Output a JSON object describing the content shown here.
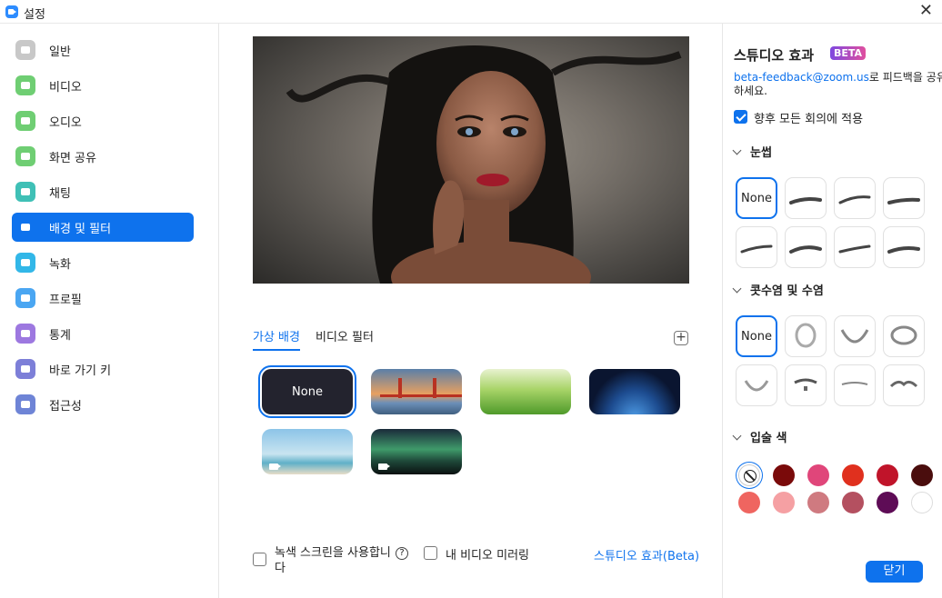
{
  "window": {
    "title": "설정",
    "close_glyph": "✕"
  },
  "sidebar": {
    "items": [
      {
        "label": "일반",
        "icon": "gear-icon",
        "color": "#c8c8c8"
      },
      {
        "label": "비디오",
        "icon": "video-icon",
        "color": "#6fce73"
      },
      {
        "label": "오디오",
        "icon": "headphones-icon",
        "color": "#6fce73"
      },
      {
        "label": "화면 공유",
        "icon": "screen-share-icon",
        "color": "#6fce73"
      },
      {
        "label": "채팅",
        "icon": "chat-icon",
        "color": "#3fc0b6"
      },
      {
        "label": "배경 및 필터",
        "icon": "person-card-icon",
        "color": "#0e72ed",
        "active": true
      },
      {
        "label": "녹화",
        "icon": "record-icon",
        "color": "#32b7e8"
      },
      {
        "label": "프로필",
        "icon": "profile-icon",
        "color": "#4aa6f2"
      },
      {
        "label": "통계",
        "icon": "stats-icon",
        "color": "#9d78e0"
      },
      {
        "label": "바로 가기 키",
        "icon": "keyboard-icon",
        "color": "#7d7fd8"
      },
      {
        "label": "접근성",
        "icon": "accessibility-icon",
        "color": "#6e84d6"
      }
    ]
  },
  "center": {
    "tabs": [
      {
        "label": "가상 배경",
        "active": true
      },
      {
        "label": "비디오 필터",
        "active": false
      }
    ],
    "add_glyph": "+",
    "backgrounds": [
      {
        "label": "None",
        "kind": "none",
        "selected": true
      },
      {
        "kind": "golden-gate"
      },
      {
        "kind": "grass"
      },
      {
        "kind": "earth"
      },
      {
        "kind": "beach",
        "video": true
      },
      {
        "kind": "aurora",
        "video": true
      }
    ],
    "green_screen_label": "녹색 스크린을 사용합니다",
    "help_glyph": "?",
    "mirror_label": "내 비디오 미러링",
    "studio_link": "스튜디오 효과(Beta)"
  },
  "studio": {
    "title": "스튜디오 효과",
    "beta": "BETA",
    "feedback_link": "beta-feedback@zoom.us",
    "feedback_text": "로 피드백을 공유하세요.",
    "apply_label": "향후 모든 회의에 적용",
    "apply_checked": true,
    "eyebrows": {
      "title": "눈썹",
      "none_label": "None"
    },
    "mustache": {
      "title": "콧수염 및 수염",
      "none_label": "None"
    },
    "lip": {
      "title": "입술 색",
      "colors": [
        "#7a0a0a",
        "#e0467a",
        "#e0301e",
        "#c0142a",
        "#4a0d0d",
        "#ef6560",
        "#f5a0a3",
        "#cf7a80",
        "#b45060",
        "#5e0c56",
        "#ffffff"
      ]
    }
  },
  "footer": {
    "close_label": "닫기"
  }
}
